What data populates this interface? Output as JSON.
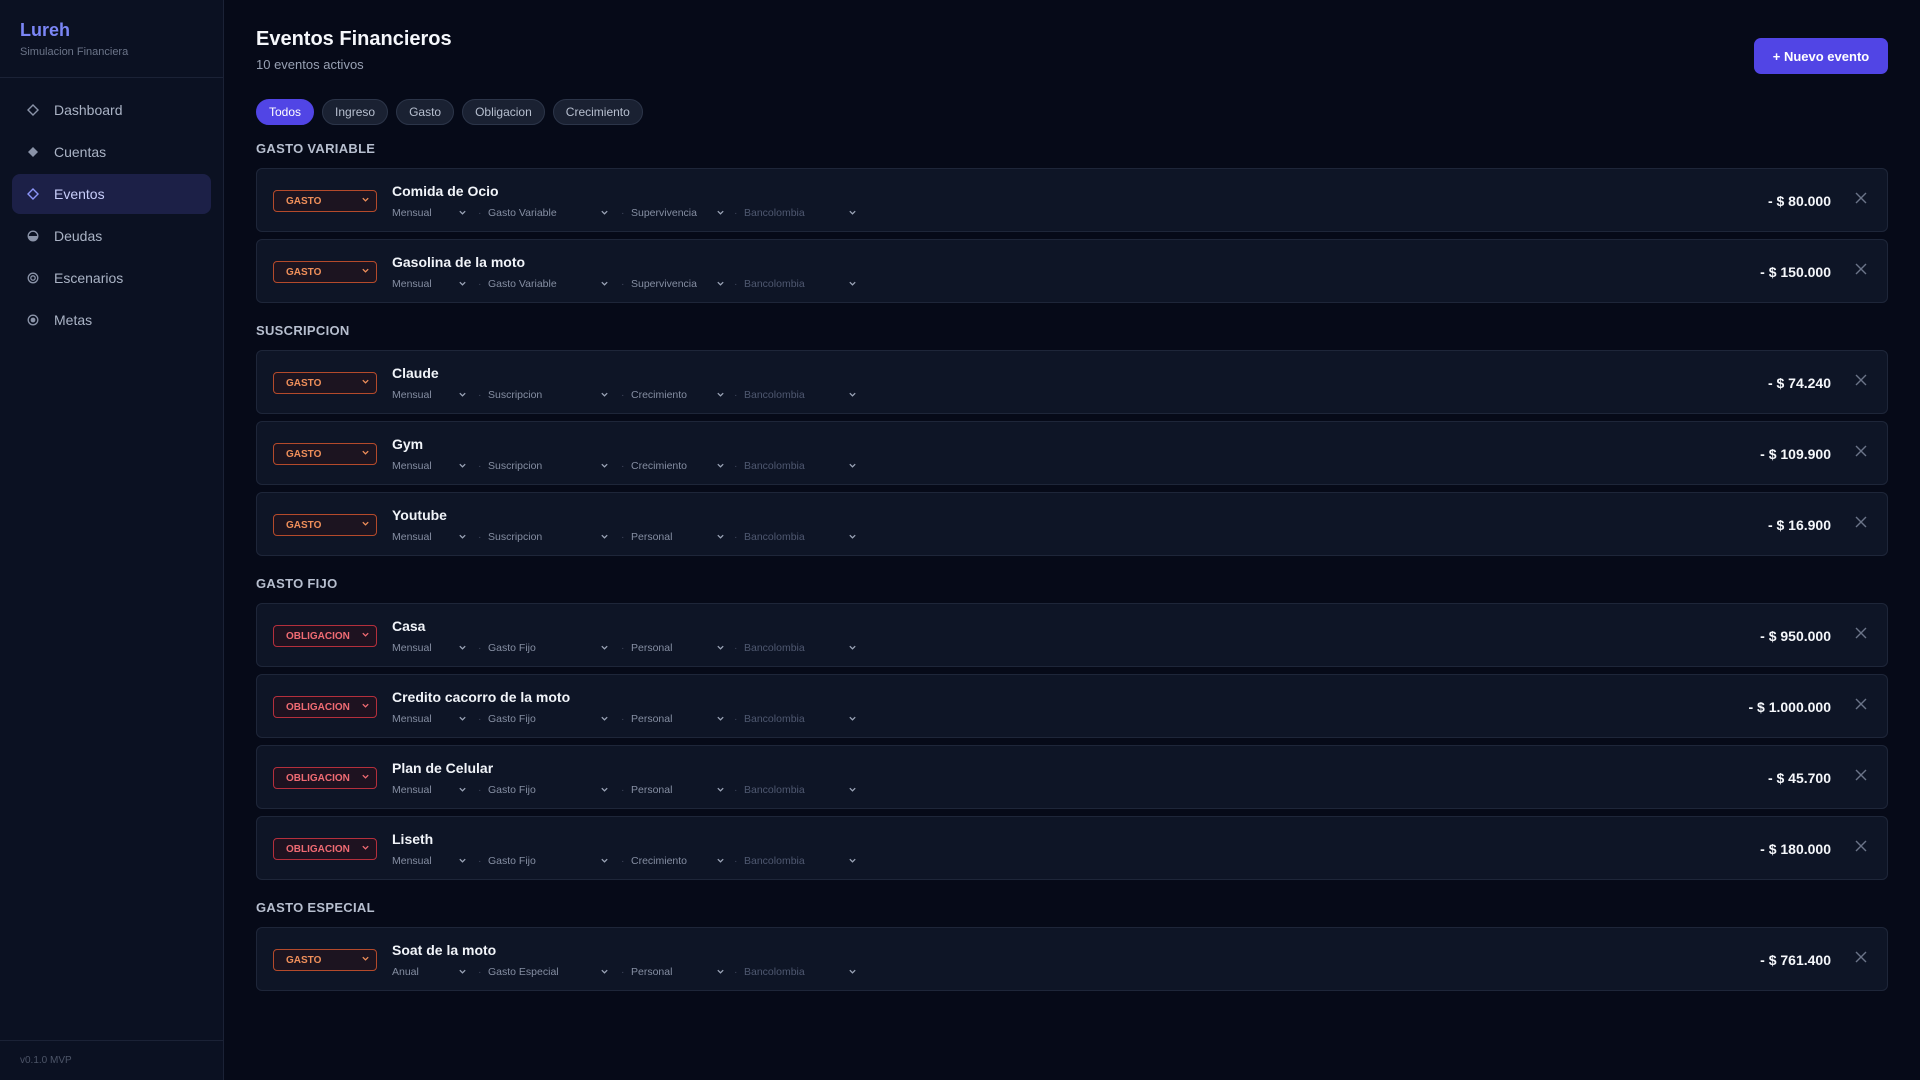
{
  "sidebar": {
    "brand": "Lureh",
    "subtitle": "Simulacion Financiera",
    "items": [
      {
        "label": "Dashboard",
        "icon": "diamond-outline-icon",
        "active": false
      },
      {
        "label": "Cuentas",
        "icon": "diamond-filled-icon",
        "active": false
      },
      {
        "label": "Eventos",
        "icon": "diamond-outline-icon",
        "active": true
      },
      {
        "label": "Deudas",
        "icon": "half-circle-icon",
        "active": false
      },
      {
        "label": "Escenarios",
        "icon": "target-icon",
        "active": false
      },
      {
        "label": "Metas",
        "icon": "record-icon",
        "active": false
      }
    ],
    "version": "v0.1.0 MVP"
  },
  "header": {
    "title": "Eventos Financieros",
    "subtitle": "10 eventos activos",
    "new_button": "+ Nuevo evento"
  },
  "filters": [
    "Todos",
    "Ingreso",
    "Gasto",
    "Obligacion",
    "Crecimiento"
  ],
  "groups": [
    {
      "label": "GASTO VARIABLE",
      "events": [
        {
          "type": "GASTO",
          "name": "Comida de Ocio",
          "freq": "Mensual",
          "cat": "Gasto Variable",
          "tag": "Supervivencia",
          "account": "Bancolombia",
          "amount": "- $ 80.000"
        },
        {
          "type": "GASTO",
          "name": "Gasolina de la moto",
          "freq": "Mensual",
          "cat": "Gasto Variable",
          "tag": "Supervivencia",
          "account": "Bancolombia",
          "amount": "- $ 150.000"
        }
      ]
    },
    {
      "label": "SUSCRIPCION",
      "events": [
        {
          "type": "GASTO",
          "name": "Claude",
          "freq": "Mensual",
          "cat": "Suscripcion",
          "tag": "Crecimiento",
          "account": "Bancolombia",
          "amount": "- $ 74.240"
        },
        {
          "type": "GASTO",
          "name": "Gym",
          "freq": "Mensual",
          "cat": "Suscripcion",
          "tag": "Crecimiento",
          "account": "Bancolombia",
          "amount": "- $ 109.900"
        },
        {
          "type": "GASTO",
          "name": "Youtube",
          "freq": "Mensual",
          "cat": "Suscripcion",
          "tag": "Personal",
          "account": "Bancolombia",
          "amount": "- $ 16.900"
        }
      ]
    },
    {
      "label": "GASTO FIJO",
      "events": [
        {
          "type": "OBLIGACION",
          "name": "Casa",
          "freq": "Mensual",
          "cat": "Gasto Fijo",
          "tag": "Personal",
          "account": "Bancolombia",
          "amount": "- $ 950.000"
        },
        {
          "type": "OBLIGACION",
          "name": "Credito cacorro de la moto",
          "freq": "Mensual",
          "cat": "Gasto Fijo",
          "tag": "Personal",
          "account": "Bancolombia",
          "amount": "- $ 1.000.000"
        },
        {
          "type": "OBLIGACION",
          "name": "Plan de Celular",
          "freq": "Mensual",
          "cat": "Gasto Fijo",
          "tag": "Personal",
          "account": "Bancolombia",
          "amount": "- $ 45.700"
        },
        {
          "type": "OBLIGACION",
          "name": "Liseth",
          "freq": "Mensual",
          "cat": "Gasto Fijo",
          "tag": "Crecimiento",
          "account": "Bancolombia",
          "amount": "- $ 180.000"
        }
      ]
    },
    {
      "label": "GASTO ESPECIAL",
      "events": [
        {
          "type": "GASTO",
          "name": "Soat de la moto",
          "freq": "Anual",
          "cat": "Gasto Especial",
          "tag": "Personal",
          "account": "Bancolombia",
          "amount": "- $ 761.400"
        }
      ]
    }
  ],
  "colors": {
    "accent": "#5145e5",
    "gasto": "#ef8f5a",
    "obligacion": "#f06b73",
    "background": "#060a18"
  }
}
